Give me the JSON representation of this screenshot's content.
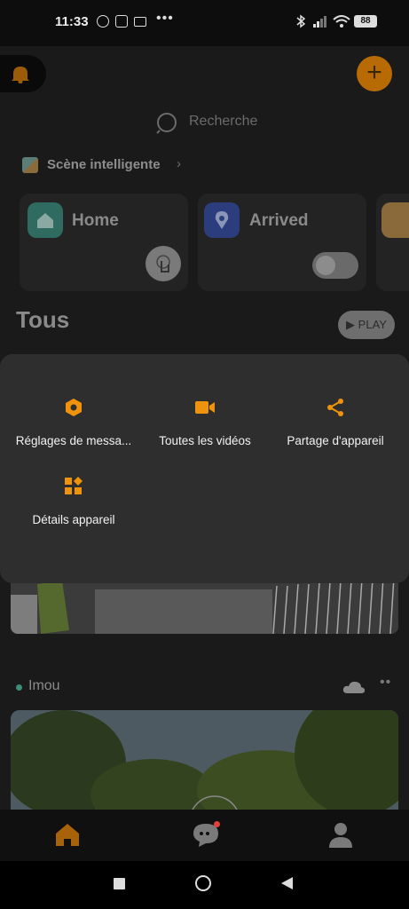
{
  "status_bar": {
    "time": "11:33",
    "more": "•••",
    "battery": "88"
  },
  "search": {
    "placeholder": "Recherche"
  },
  "scene": {
    "link_label": "Scène intelligente",
    "cards": [
      {
        "name": "Home",
        "color": "#3e8a7c"
      },
      {
        "name": "Arrived",
        "color": "#2f4fa8"
      }
    ]
  },
  "section": {
    "title": "Tous",
    "play_label": "PLAY"
  },
  "device": {
    "name": "Imou"
  },
  "menu": {
    "accent": "#f0930c",
    "items": [
      {
        "label": "Réglages de messa...",
        "icon": "message-settings-icon"
      },
      {
        "label": "Toutes les vidéos",
        "icon": "video-camera-icon"
      },
      {
        "label": "Partage d'appareil",
        "icon": "share-icon"
      },
      {
        "label": "Détails appareil",
        "icon": "device-details-icon"
      }
    ]
  },
  "bottom_nav": {
    "items": [
      {
        "name": "home",
        "icon": "home-icon",
        "active": true
      },
      {
        "name": "messages",
        "icon": "chat-icon",
        "badge": true
      },
      {
        "name": "profile",
        "icon": "person-icon"
      }
    ]
  }
}
